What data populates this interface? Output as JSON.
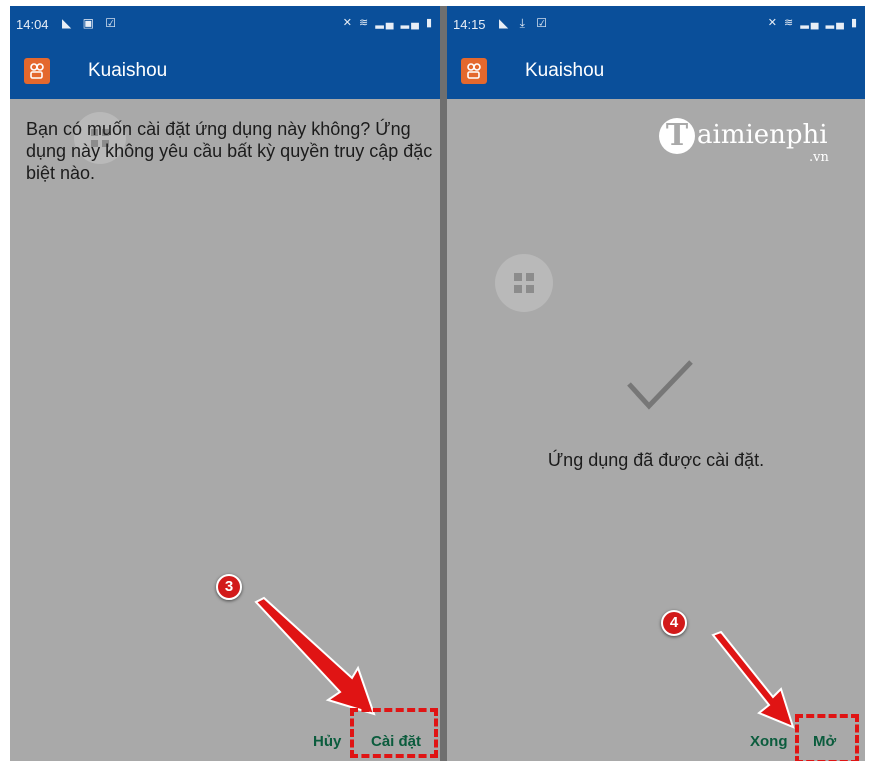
{
  "colors": {
    "app_bar": "#0a4f9a",
    "screen_bg": "#a9a9a9",
    "button_text": "#0b5c3d",
    "highlight": "#e01414",
    "app_icon": "#e4682d"
  },
  "left_screen": {
    "status": {
      "time": "14:04",
      "icons": [
        "cast-icon",
        "image-icon",
        "notification-icon"
      ],
      "right_icons": [
        "mute-icon",
        "wifi-icon",
        "signal-icon",
        "battery-icon"
      ]
    },
    "app_title": "Kuaishou",
    "question": "Bạn có muốn cài đặt ứng dụng này không? Ứng dụng này không yêu cầu bất kỳ quyền truy cập đặc biệt nào.",
    "cancel_label": "Hủy",
    "install_label": "Cài đặt",
    "step_number": "3"
  },
  "right_screen": {
    "status": {
      "time": "14:15",
      "icons": [
        "cast-icon",
        "download-icon",
        "notification-icon"
      ],
      "right_icons": [
        "mute-icon",
        "wifi-icon",
        "signal-icon",
        "battery-icon"
      ]
    },
    "app_title": "Kuaishou",
    "success_message": "Ứng dụng đã được cài đặt.",
    "done_label": "Xong",
    "open_label": "Mở",
    "step_number": "4",
    "watermark": {
      "main": "aimienphi",
      "initial": "T",
      "sub": ".vn"
    }
  }
}
